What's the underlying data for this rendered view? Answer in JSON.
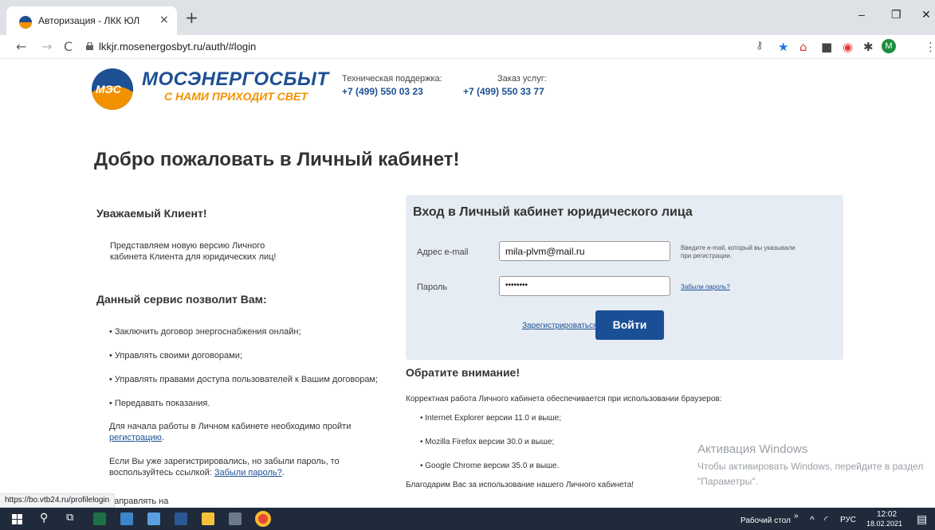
{
  "browser": {
    "tab_title": "Авторизация - ЛКК ЮЛ",
    "tab_close": "×",
    "new_tab": "+",
    "url": "lkkjr.mosenergosbyt.ru/auth/#login",
    "win_min": "–",
    "win_restore": "❐",
    "win_close": "✕",
    "avatar_letter": "M",
    "status_url": "https://bo.vtb24.ru/profilelogin"
  },
  "header": {
    "logo_badge": "МЭС",
    "logo_name": "МОСЭНЕРГОСБЫТ",
    "logo_slogan": "С НАМИ ПРИХОДИТ СВЕТ",
    "support_label": "Техническая поддержка:",
    "support_phone": "+7 (499) 550 03 23",
    "orders_label": "Заказ услуг:",
    "orders_phone": "+7 (499) 550 33 77"
  },
  "welcome": "Добро пожаловать в Личный кабинет!",
  "left": {
    "heading1": "Уважаемый Клиент!",
    "intro_line1": "Представляем новую версию Личного",
    "intro_line2": "кабинета Клиента для юридических лиц!",
    "heading2": "Данный сервис позволит Вам:",
    "bullets": [
      "• Заключить договор энергоснабжения онлайн;",
      "• Управлять своими договорами;",
      "• Управлять правами доступа пользователей к Вашим договорам;",
      "• Передавать показания."
    ],
    "start_line1": "Для начала работы в Личном кабинете необходимо пройти",
    "start_link": "регистрацию",
    "start_end": ".",
    "forgot_line1": "Если Вы уже зарегистрировались, но забыли пароль, то",
    "forgot_line2": "воспользуйтесь ссылкой: ",
    "forgot_link": "Забыли пароль?",
    "forgot_end": ".",
    "cut_text": "направлять на"
  },
  "login": {
    "title": "Вход в Личный кабинет юридического лица",
    "email_label": "Адрес e-mail",
    "email_value": "mila-plvm@mail.ru",
    "email_hint_line1": "Введите e-mail, который вы указывали",
    "email_hint_line2": "при регистрации.",
    "password_label": "Пароль",
    "password_value": "••••••••",
    "forgot_link": "Забыли пароль?",
    "register_link": "Зарегистрироваться",
    "submit": "Войти"
  },
  "notice": {
    "title": "Обратите внимание!",
    "text": "Корректная работа Личного кабинета обеспечивается при использовании браузеров:",
    "browsers": [
      "•  Internet Explorer версии 11.0 и выше;",
      "•  Mozilla Firefox версии 30.0 и выше;",
      "•  Google Chrome версии 35.0 и выше."
    ],
    "thanks": "Благодарим Вас за использование нашего Личного кабинета!"
  },
  "watermark": {
    "title": "Активация Windows",
    "text": "Чтобы активировать Windows, перейдите в раздел \"Параметры\"."
  },
  "taskbar": {
    "desktop_label": "Рабочий стол",
    "chevron": "»",
    "lang": "РУС",
    "time": "12:02",
    "date": "18.02.2021"
  }
}
